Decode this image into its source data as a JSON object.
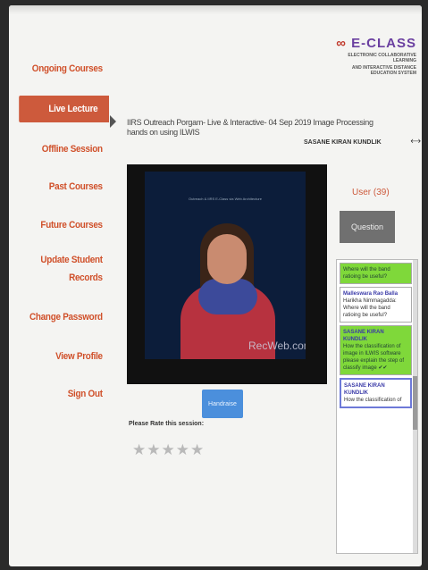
{
  "logo": {
    "mark_prefix": "",
    "mark_text": "E-CLASS",
    "subtitle_1": "ELECTRONIC COLLABORATIVE LEARNING",
    "subtitle_2": "AND INTERACTIVE DISTANCE EDUCATION SYSTEM"
  },
  "sidebar": {
    "items": [
      {
        "label": "Ongoing Courses"
      },
      {
        "label": "Live Lecture"
      },
      {
        "label": "Offline Session"
      },
      {
        "label": "Past Courses"
      },
      {
        "label": "Future Courses"
      },
      {
        "label": "Update Student"
      },
      {
        "label": "Records"
      },
      {
        "label": "Change Password"
      },
      {
        "label": "View Profile"
      },
      {
        "label": "Sign Out"
      }
    ]
  },
  "lecture": {
    "title": "IIRS Outreach Porgam- Live & Interactive- 04 Sep 2019 Image Processing hands on using ILWIS",
    "author": "SASANE KIRAN KUNDLIK"
  },
  "video": {
    "watermark": "RecWeb.com",
    "slide_caption": "Outreach & IIRS E-Class via Web Architecture"
  },
  "controls": {
    "handraise_label": "Handraise",
    "rate_label": "Please Rate this session:",
    "stars": "★★★★★"
  },
  "panel": {
    "user_count": "User (39)",
    "question_label": "Question",
    "messages": [
      {
        "name": "",
        "text": "Where will the band ratioing be useful?",
        "style": "green"
      },
      {
        "name": "Malleswara Rao Balla",
        "text": "Harikha Nimmagadda: Where will the band ratioing be useful?",
        "style": "white"
      },
      {
        "name": "SASANE KIRAN KUNDLIK",
        "text": "How the classification of image in ILWIS software please explain the step of classify image ✔✔",
        "style": "green"
      },
      {
        "name": "SASANE KIRAN KUNDLIK",
        "text": "How the classification of",
        "style": "blue"
      }
    ]
  }
}
